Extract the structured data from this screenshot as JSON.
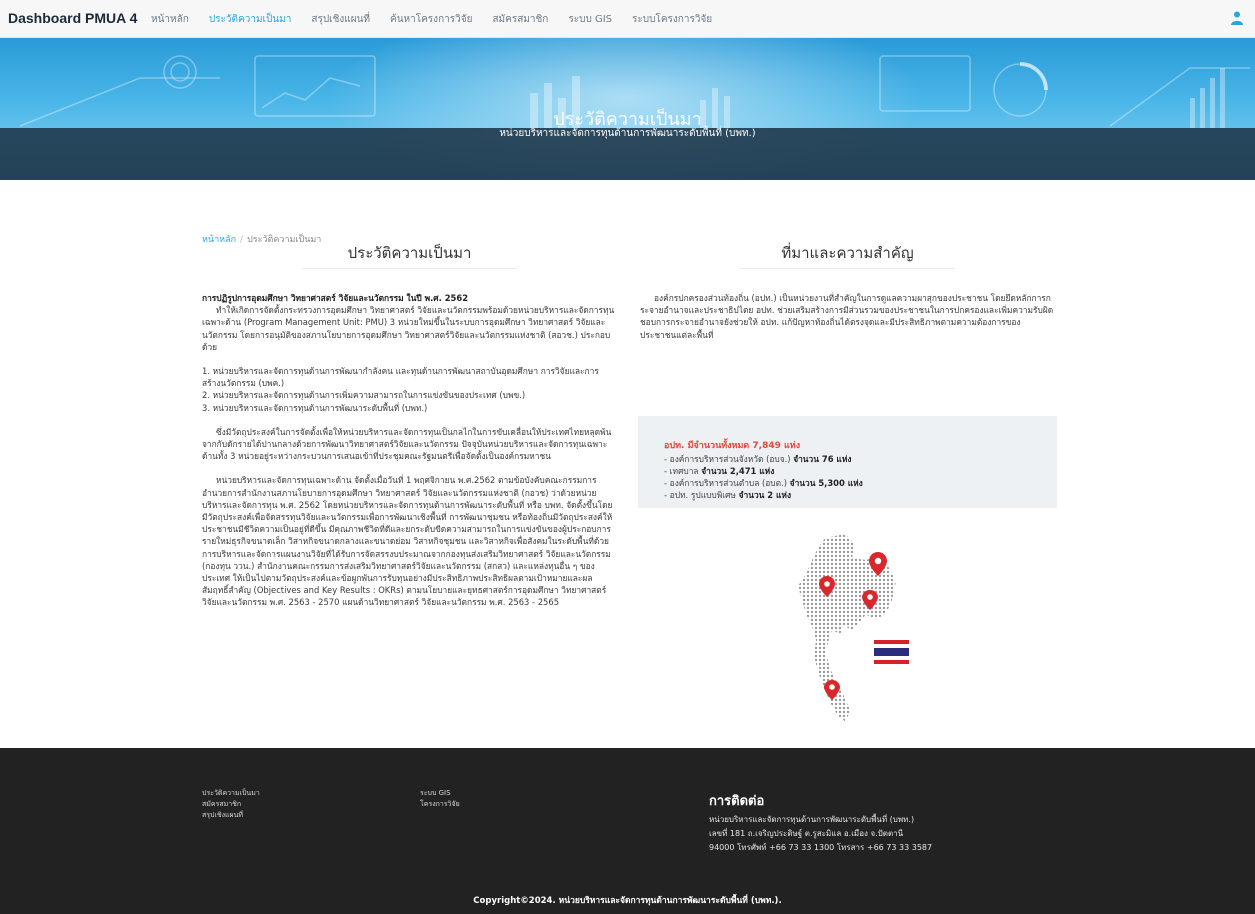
{
  "brand": "Dashboard PMUA 4",
  "nav": {
    "items": [
      {
        "label": "หน้าหลัก",
        "active": false
      },
      {
        "label": "ประวัติความเป็นมา",
        "active": true
      },
      {
        "label": "สรุปเชิงแผนที่",
        "active": false
      },
      {
        "label": "ค้นหาโครงการวิจัย",
        "active": false
      },
      {
        "label": "สมัครสมาชิก",
        "active": false
      },
      {
        "label": "ระบบ GIS",
        "active": false
      },
      {
        "label": "ระบบโครงการวิจัย",
        "active": false
      }
    ],
    "user_icon": "user-icon"
  },
  "hero": {
    "title": "ประวัติความเป็นมา",
    "subtitle": "หน่วยบริหารและจัดการทุนด้านการพัฒนาระดับพื้นที่ (บพท.)"
  },
  "breadcrumb": {
    "home": "หน้าหลัก",
    "separator": "/",
    "current": "ประวัติความเป็นมา"
  },
  "left": {
    "heading": "ประวัติความเป็นมา",
    "reform_title": "การปฏิรูปการอุดมศึกษา วิทยาศาสตร์ วิจัยและนวัตกรรม ในปี พ.ศ. 2562",
    "reform_body": "ทำให้เกิดการจัดตั้งกระทรวงการอุดมศึกษา วิทยาศาสตร์ วิจัยและนวัตกรรมพร้อมด้วยหน่วยบริหารและจัดการทุนเฉพาะด้าน (Program Management Unit: PMU) 3 หน่วยใหม่ขึ้นในระบบการอุดมศึกษา วิทยาศาสตร์ วิจัยและนวัตกรรม โดยการอนุมัติของสภานโยบายการอุดมศึกษา วิทยาศาสตร์วิจัยและนวัตกรรมแห่งชาติ (สอวช.) ประกอบด้วย",
    "list": [
      "1. หน่วยบริหารและจัดการทุนด้านการพัฒนากำลังคน และทุนด้านการพัฒนาสถาบันอุดมศึกษา การวิจัยและการสร้างนวัตกรรม (บพค.)",
      "2. หน่วยบริหารและจัดการทุนด้านการเพิ่มความสามารถในการแข่งขันของประเทศ (บพข.)",
      "3. หน่วยบริหารและจัดการทุนด้านการพัฒนาระดับพื้นที่ (บพท.)"
    ],
    "para2": "ซึ่งมีวัตถุประสงค์ในการจัดตั้งเพื่อให้หน่วยบริหารและจัดการทุนเป็นกลไกในการขับเคลื่อนให้ประเทศไทยหลุดพ้นจากกับดักรายได้ปานกลางด้วยการพัฒนาวิทยาศาสตร์วิจัยและนวัตกรรม ปัจจุบันหน่วยบริหารและจัดการทุนเฉพาะด้านทั้ง 3 หน่วยอยู่ระหว่างกระบวนการเสนอเข้าที่ประชุมคณะรัฐมนตรีเพื่อจัดตั้งเป็นองค์กรมหาชน",
    "para3": "หน่วยบริหารและจัดการทุนเฉพาะด้าน จัดตั้งเมื่อวันที่ 1 พฤศจิกายน พ.ศ.2562 ตามข้อบังคับคณะกรรมการอำนวยการสำนักงานสภานโยบายการอุดมศึกษา วิทยาศาสตร์ วิจัยและนวัตกรรมแห่งชาติ (กอวช) ว่าด้วยหน่วยบริหารและจัดการทุน พ.ศ. 2562 โดยหน่วยบริหารและจัดการทุนด้านการพัฒนาระดับพื้นที่ หรือ บพท. จัดตั้งขึ้นโดยมีวัตถุประสงค์เพื่อจัดสรรทุนวิจัยและนวัตกรรมเพื่อการพัฒนาเชิงพื้นที่ การพัฒนาชุมชน หรือท้องถิ่นมีวัตถุประสงค์ให้ประชาชนมีชีวิตความเป็นอยู่ที่ดีขึ้น มีคุณภาพชีวิตที่ดีและยกระดับขีดความสามารถในการแข่งขันของผู้ประกอบการรายใหม่ธุรกิจขนาดเล็ก วิสาหกิจขนาดกลางและขนาดย่อม วิสาหกิจชุมชน และวิสาหกิจเพื่อสังคมในระดับพื้นที่ด้วยการบริหารและจัดการแผนงานวิจัยที่ได้รับการจัดสรรงบประมาณจากกองทุนส่งเสริมวิทยาศาสตร์ วิจัยและนวัตกรรม (กองทุน ววน.) สำนักงานคณะกรรมการส่งเสริมวิทยาศาสตร์วิจัยและนวัตกรรม (สกสว) และแหล่งทุนอื่น ๆ ของประเทศ ให้เป็นไปตามวัตถุประสงค์และข้อผูกพันการรับทุนอย่างมีประสิทธิภาพประสิทธิผลตามเป้าหมายและผลสัมฤทธิ์สำคัญ (Objectives and Key Results : OKRs) ตามนโยบายและยุทธศาสตร์การอุดมศึกษา วิทยาศาสตร์ วิจัยและนวัตกรรม พ.ศ. 2563 - 2570 แผนด้านวิทยาศาสตร์ วิจัยและนวัตกรรม พ.ศ. 2563 - 2565"
  },
  "right": {
    "heading": "ที่มาและความสำคัญ",
    "body": "องค์กรปกครองส่วนท้องถิ่น (อปท.) เป็นหน่วยงานที่สำคัญในการดูแลความผาสุกของประชาชน โดยยึดหลักการกระจายอำนาจและประชาธิปไตย อปท. ช่วยเสริมสร้างการมีส่วนรวมของประชาชนในการปกครองและเพิ่มความรับผิดชอบการกระจายอำนาจยังช่วยให้ อปท. แก้ปัญหาท้องถิ่นได้ตรงจุดและมีประสิทธิภาพตามความต้องการของประชาชนแต่ละพื้นที่",
    "stats": {
      "title": "อปท. มีจำนวนทั้งหมด 7,849 แห่ง",
      "items": [
        {
          "prefix": "- องค์การบริหารส่วนจังหวัด (อบจ.) ",
          "value": "จำนวน 76 แห่ง"
        },
        {
          "prefix": "- เทศบาล ",
          "value": "จำนวน 2,471 แห่ง"
        },
        {
          "prefix": "- องค์การบริหารส่วนตำบล (อบต.) ",
          "value": "จำนวน 5,300 แห่ง"
        },
        {
          "prefix": "- อปท. รูปแบบพิเศษ ",
          "value": "จำนวน 2 แห่ง"
        }
      ]
    },
    "map_icon": "thailand-map-icon",
    "flag_icon": "thai-flag-icon"
  },
  "footer": {
    "col1": [
      "ประวัติความเป็นมา",
      "สมัครสมาชิก",
      "สรุปเชิงแผนที่"
    ],
    "col2": [
      "ระบบ GIS",
      "โครงการวิจัย"
    ],
    "contact_title": "การติดต่อ",
    "contact_lines": [
      "หน่วยบริหารและจัดการทุนด้านการพัฒนาระดับพื้นที่ (บพท.)",
      "เลขที่ 181 ถ.เจริญประดิษฐ์ ต.รูสะมิแล อ.เมือง จ.ปัตตานี",
      "94000 โทรศัพท์ +66 73 33 1300 โทรสาร +66 73 33 3587"
    ],
    "copyright": "Copyright©2024. หน่วยบริหารและจัดการทุนด้านการพัฒนาระดับพื้นที่ (บพท.)."
  },
  "colors": {
    "accent": "#29a7dc",
    "stats_red": "#e2483c",
    "footer_bg": "#222222",
    "hero_band": "#1c3448"
  }
}
